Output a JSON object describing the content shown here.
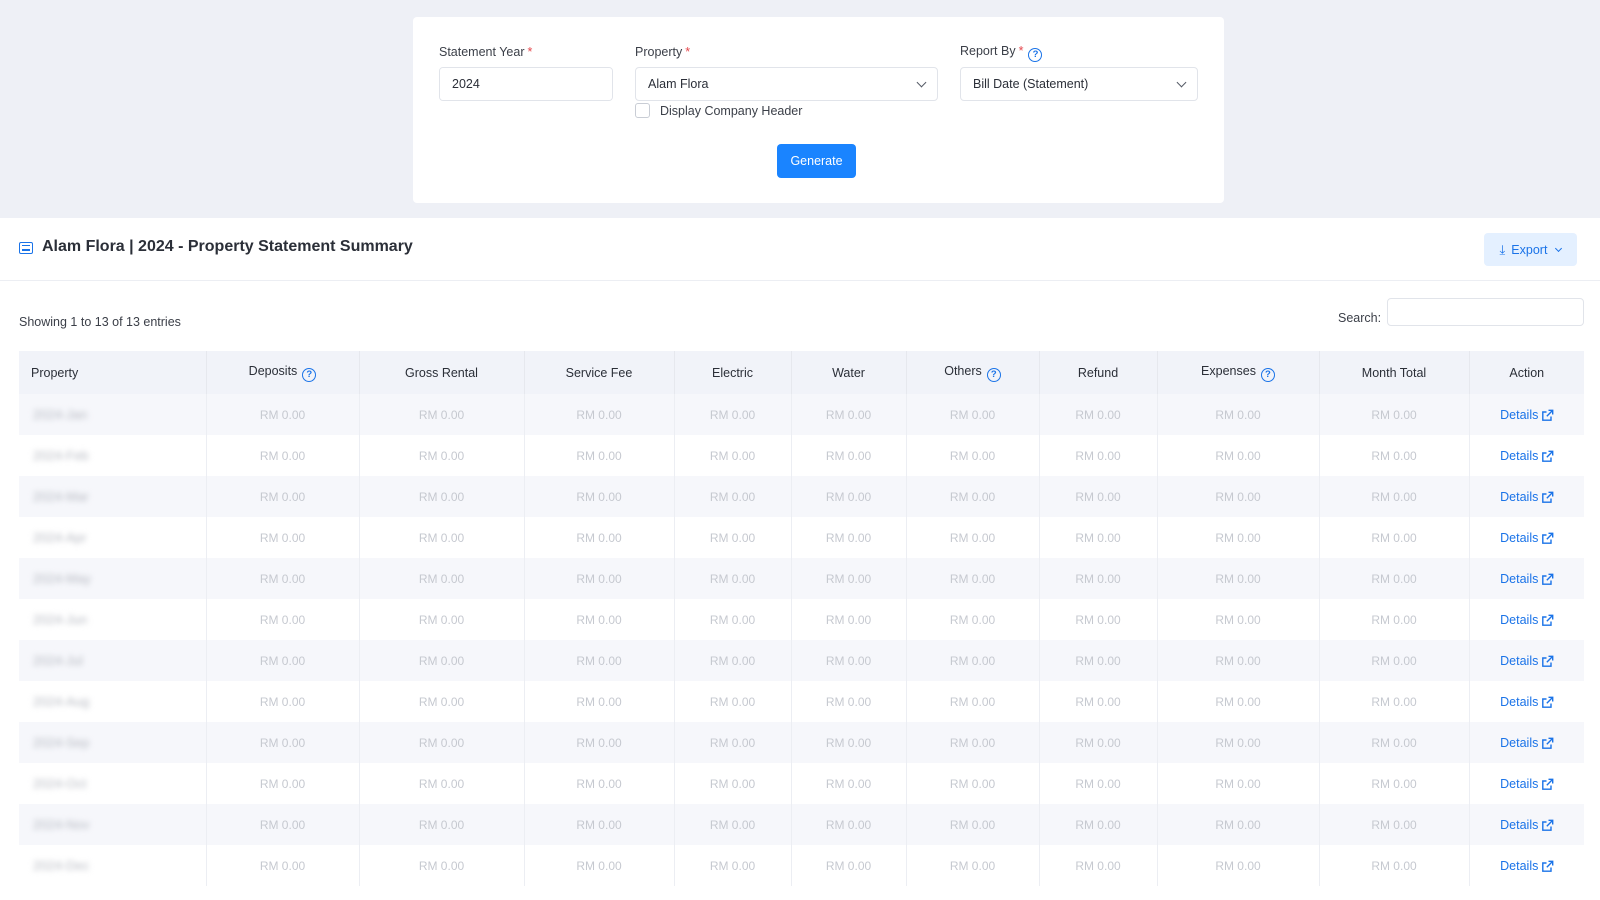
{
  "filters": {
    "statement_year_label": "Statement Year",
    "statement_year_value": "2024",
    "property_label": "Property",
    "property_value": "Alam Flora",
    "report_by_label": "Report By",
    "report_by_value": "Bill Date (Statement)",
    "display_header_label": "Display Company Header",
    "display_header_checked": false,
    "required_mark": "*",
    "generate_label": "Generate"
  },
  "report": {
    "title": "Alam Flora | 2024 - Property Statement Summary",
    "export_label": "Export",
    "entries_info": "Showing 1 to 13 of 13 entries",
    "search_label": "Search:",
    "search_value": ""
  },
  "table": {
    "headers": [
      "Property",
      "Deposits",
      "Gross Rental",
      "Service Fee",
      "Electric",
      "Water",
      "Others",
      "Refund",
      "Expenses",
      "Month Total",
      "Action"
    ],
    "rows": [
      {
        "property": "2024-Jan",
        "values": [
          "RM 0.00",
          "RM 0.00",
          "RM 0.00",
          "RM 0.00",
          "RM 0.00",
          "RM 0.00",
          "RM 0.00",
          "RM 0.00",
          "RM 0.00"
        ],
        "action": "Details"
      },
      {
        "property": "2024-Feb",
        "values": [
          "RM 0.00",
          "RM 0.00",
          "RM 0.00",
          "RM 0.00",
          "RM 0.00",
          "RM 0.00",
          "RM 0.00",
          "RM 0.00",
          "RM 0.00"
        ],
        "action": "Details"
      },
      {
        "property": "2024-Mar",
        "values": [
          "RM 0.00",
          "RM 0.00",
          "RM 0.00",
          "RM 0.00",
          "RM 0.00",
          "RM 0.00",
          "RM 0.00",
          "RM 0.00",
          "RM 0.00"
        ],
        "action": "Details"
      },
      {
        "property": "2024-Apr",
        "values": [
          "RM 0.00",
          "RM 0.00",
          "RM 0.00",
          "RM 0.00",
          "RM 0.00",
          "RM 0.00",
          "RM 0.00",
          "RM 0.00",
          "RM 0.00"
        ],
        "action": "Details"
      },
      {
        "property": "2024-May",
        "values": [
          "RM 0.00",
          "RM 0.00",
          "RM 0.00",
          "RM 0.00",
          "RM 0.00",
          "RM 0.00",
          "RM 0.00",
          "RM 0.00",
          "RM 0.00"
        ],
        "action": "Details"
      },
      {
        "property": "2024-Jun",
        "values": [
          "RM 0.00",
          "RM 0.00",
          "RM 0.00",
          "RM 0.00",
          "RM 0.00",
          "RM 0.00",
          "RM 0.00",
          "RM 0.00",
          "RM 0.00"
        ],
        "action": "Details"
      },
      {
        "property": "2024-Jul",
        "values": [
          "RM 0.00",
          "RM 0.00",
          "RM 0.00",
          "RM 0.00",
          "RM 0.00",
          "RM 0.00",
          "RM 0.00",
          "RM 0.00",
          "RM 0.00"
        ],
        "action": "Details"
      },
      {
        "property": "2024-Aug",
        "values": [
          "RM 0.00",
          "RM 0.00",
          "RM 0.00",
          "RM 0.00",
          "RM 0.00",
          "RM 0.00",
          "RM 0.00",
          "RM 0.00",
          "RM 0.00"
        ],
        "action": "Details"
      },
      {
        "property": "2024-Sep",
        "values": [
          "RM 0.00",
          "RM 0.00",
          "RM 0.00",
          "RM 0.00",
          "RM 0.00",
          "RM 0.00",
          "RM 0.00",
          "RM 0.00",
          "RM 0.00"
        ],
        "action": "Details"
      },
      {
        "property": "2024-Oct",
        "values": [
          "RM 0.00",
          "RM 0.00",
          "RM 0.00",
          "RM 0.00",
          "RM 0.00",
          "RM 0.00",
          "RM 0.00",
          "RM 0.00",
          "RM 0.00"
        ],
        "action": "Details"
      },
      {
        "property": "2024-Nov",
        "values": [
          "RM 0.00",
          "RM 0.00",
          "RM 0.00",
          "RM 0.00",
          "RM 0.00",
          "RM 0.00",
          "RM 0.00",
          "RM 0.00",
          "RM 0.00"
        ],
        "action": "Details"
      },
      {
        "property": "2024-Dec",
        "values": [
          "RM 0.00",
          "RM 0.00",
          "RM 0.00",
          "RM 0.00",
          "RM 0.00",
          "RM 0.00",
          "RM 0.00",
          "RM 0.00",
          "RM 0.00"
        ],
        "action": "Details"
      }
    ]
  },
  "colors": {
    "accent": "#1a84ff",
    "link": "#1a73e8",
    "required": "#e5484d",
    "page_bg": "#eef0f6"
  },
  "icons": {
    "calendar": "calendar-icon",
    "help": "help-circle-icon",
    "list": "list-icon",
    "download": "download-icon",
    "external": "external-link-icon"
  }
}
